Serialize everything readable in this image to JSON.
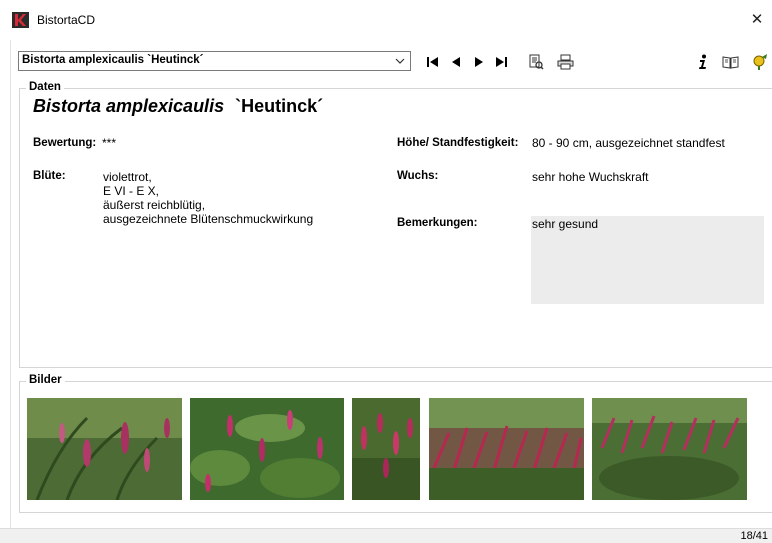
{
  "window": {
    "title": "BistortaCD",
    "close_label": "✕"
  },
  "toolbar": {
    "combo_value": "Bistorta amplexicaulis `Heutinck´",
    "nav_first": "⏮",
    "nav_prev": "◀",
    "nav_next": "▶",
    "nav_last": "⏭"
  },
  "daten": {
    "legend": "Daten",
    "genus_species": "Bistorta amplexicaulis",
    "cultivar": "`Heutinck´",
    "bewertung_label": "Bewertung:",
    "bewertung_value": "***",
    "bluete_label": "Blüte:",
    "bluete_lines": [
      "violettrot,",
      "E VI - E X,",
      "äußerst reichblütig,",
      "ausgezeichnete Blütenschmuckwirkung"
    ],
    "hoehe_label": "Höhe/ Standfestigkeit:",
    "hoehe_value": "80 - 90 cm, ausgezeichnet standfest",
    "wuchs_label": "Wuchs:",
    "wuchs_value": "sehr hohe Wuchskraft",
    "bemerkungen_label": "Bemerkungen:",
    "bemerkungen_value": "sehr gesund"
  },
  "bilder": {
    "legend": "Bilder"
  },
  "status": {
    "record_counter": "18/41"
  },
  "colors": {
    "accent": "#c0142c",
    "group_border": "#d5d5d5",
    "remarks_bg": "#ececec"
  }
}
